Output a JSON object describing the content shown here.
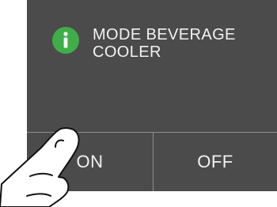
{
  "message": {
    "icon": "info-icon",
    "text": "MODE BEVERAGE COOLER"
  },
  "buttons": {
    "on_label": "ON",
    "off_label": "OFF"
  },
  "colors": {
    "panel": "#4b4b4b",
    "icon": "#3fae49",
    "text": "#f2f2f2",
    "divider": "#8e8e8e"
  }
}
